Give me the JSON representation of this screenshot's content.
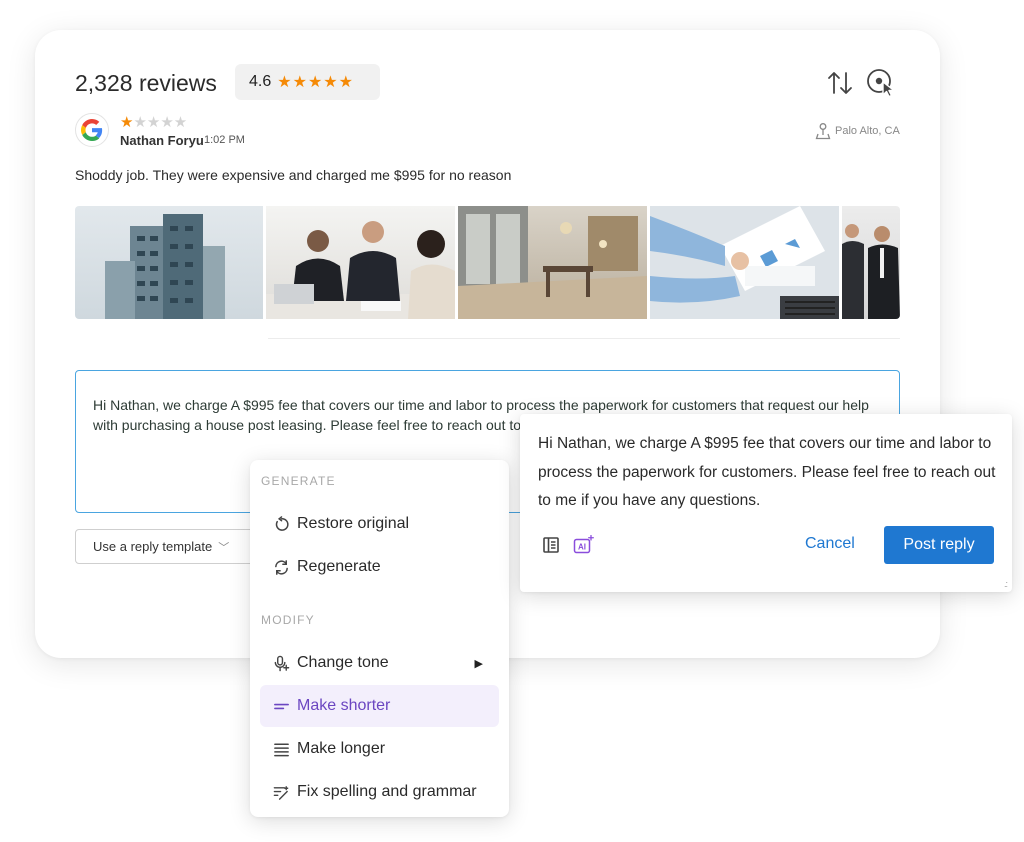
{
  "header": {
    "reviews_count": "2,328 reviews",
    "rating": "4.6",
    "rating_stars": "★★★★★"
  },
  "review": {
    "source_icon": "google-logo",
    "stars_filled": 1,
    "stars_total": 5,
    "reviewer": "Nathan Foryu",
    "time": "1:02 PM",
    "location": "Palo Alto, CA",
    "text": "Shoddy job. They were expensive and charged me $995 for no reason",
    "photos": [
      {
        "subject": "apartment-building"
      },
      {
        "subject": "business-meeting"
      },
      {
        "subject": "apartment-interior"
      },
      {
        "subject": "documents-charts"
      },
      {
        "subject": "business-people"
      }
    ]
  },
  "reply": {
    "text": "Hi Nathan, we charge A $995 fee that covers our time and labor to process the paperwork for customers that request our help with purchasing a house post leasing. Please feel free to reach out to me if you have any questions, I am happy to help.",
    "template_button": "Use a reply template"
  },
  "ai_menu": {
    "generate_heading": "GENERATE",
    "restore": "Restore original",
    "regenerate": "Regenerate",
    "modify_heading": "MODIFY",
    "change_tone": "Change tone",
    "make_shorter": "Make shorter",
    "make_longer": "Make longer",
    "fix_spelling": "Fix spelling and grammar",
    "accent_color": "#6b46c1"
  },
  "popup": {
    "text": "Hi Nathan, we charge A $995 fee that covers our time and labor to process the paperwork for customers. Please feel free to reach out to me if you have any questions.",
    "cancel": "Cancel",
    "post": "Post reply",
    "primary_color": "#1f78d1"
  }
}
